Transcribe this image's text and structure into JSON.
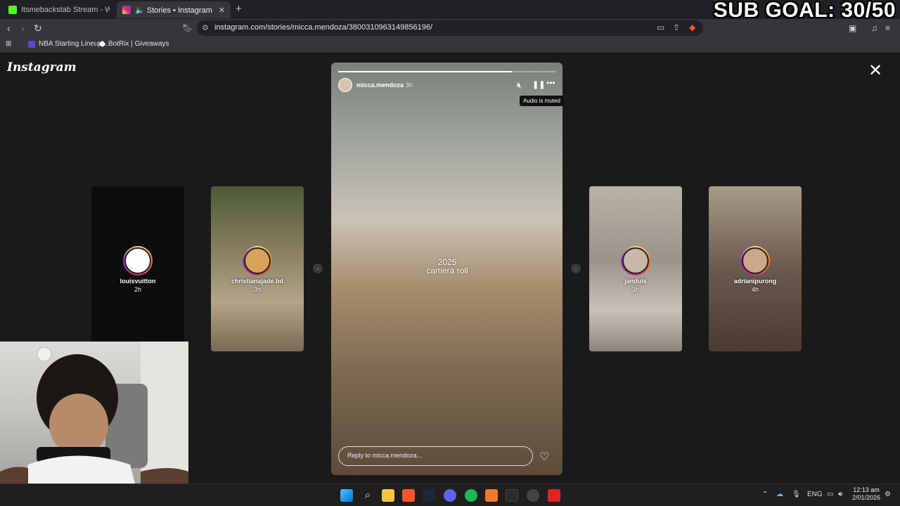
{
  "browser": {
    "tabs": [
      {
        "title": "Itsmebackstab Stream - Watch Live o",
        "favicon_color": "#53fc18",
        "active": false
      },
      {
        "title": "🔈 Stories • Instagram",
        "favicon_color": "#d62976",
        "active": true
      }
    ],
    "new_tab": "+",
    "url": "instagram.com/stories/micca.mendoza/3800310963149856196/",
    "bookmarks": [
      {
        "label": "NBA Starting Lineup...",
        "color": "#6a3fd6"
      },
      {
        "label": "BotRix | Giveaways",
        "color": "#ffffff"
      }
    ]
  },
  "overlay": {
    "sub_goal": "SUB GOAL: 30/50"
  },
  "instagram": {
    "logo": "Instagram",
    "close": "✕",
    "story": {
      "username": "micca.mendoza",
      "time": "3h",
      "progress_fraction": 0.8,
      "tooltip": "Audio is muted",
      "text_line1": "2025",
      "text_line2": "camera roll",
      "reply_placeholder": "Reply to micca.mendoza...",
      "icons": {
        "mute": "muted-speaker-icon",
        "pause": "pause-icon",
        "more": "more-icon",
        "like": "heart-icon"
      }
    },
    "previews": [
      {
        "name": "louisvuitton",
        "time": "2h",
        "bg": "#0d0d0d",
        "avatar_color": "#ffffff"
      },
      {
        "name": "christianajade.bd",
        "time": "3h",
        "bg": "#6b6a50",
        "avatar_color": "#d7a25a"
      },
      {
        "name": "janduls",
        "time": "3h",
        "bg": "#9a938a",
        "avatar_color": "#c9b8a8"
      },
      {
        "name": "adrianipurong",
        "time": "4h",
        "bg": "#6a5a4e",
        "avatar_color": "#caa88a"
      }
    ]
  },
  "taskbar": {
    "tray": {
      "lang": "ENG"
    },
    "clock": {
      "time": "12:13 am",
      "date": "2/01/2026"
    }
  }
}
